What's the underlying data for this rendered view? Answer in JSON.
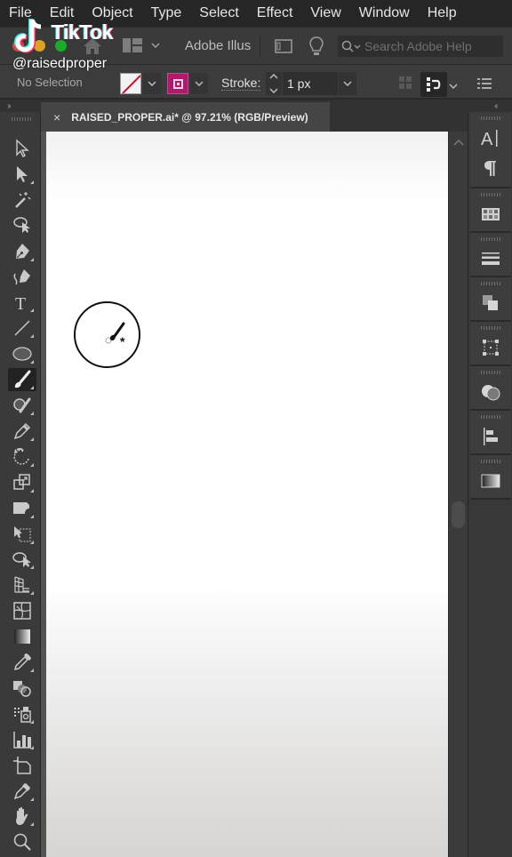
{
  "menubar": {
    "items": [
      "File",
      "Edit",
      "Object",
      "Type",
      "Select",
      "Effect",
      "View",
      "Window",
      "Help"
    ]
  },
  "appbar": {
    "workspace_label": "Adobe Illus",
    "search_placeholder": "Search Adobe Help",
    "icons": [
      "home-icon",
      "workspace-switcher-icon",
      "arrange-documents-icon",
      "lightbulb-icon",
      "search-icon"
    ]
  },
  "control_bar": {
    "selection_status": "No Selection",
    "fill": {
      "state": "none",
      "color": "#f2f2f2"
    },
    "stroke": {
      "color": "#b01a6d"
    },
    "stroke_label": "Stroke:",
    "stroke_weight": "1 px"
  },
  "document": {
    "tab_title": "RAISED_PROPER.ai* @ 97.21% (RGB/Preview)",
    "close_label": "×",
    "zoom": "97.21%",
    "color_mode": "RGB/Preview"
  },
  "toolbar": {
    "active_tool": "paintbrush-tool",
    "tools": [
      {
        "name": "selection-tool"
      },
      {
        "name": "direct-selection-tool"
      },
      {
        "name": "magic-wand-tool"
      },
      {
        "name": "lasso-tool"
      },
      {
        "name": "pen-tool"
      },
      {
        "name": "curvature-tool"
      },
      {
        "name": "type-tool"
      },
      {
        "name": "line-segment-tool"
      },
      {
        "name": "ellipse-tool"
      },
      {
        "name": "paintbrush-tool"
      },
      {
        "name": "shaper-tool"
      },
      {
        "name": "pencil-tool"
      },
      {
        "name": "rotate-tool"
      },
      {
        "name": "scale-tool"
      },
      {
        "name": "width-tool"
      },
      {
        "name": "free-transform-tool"
      },
      {
        "name": "shape-builder-tool"
      },
      {
        "name": "perspective-grid-tool"
      },
      {
        "name": "mesh-tool"
      },
      {
        "name": "gradient-tool"
      },
      {
        "name": "eyedropper-tool"
      },
      {
        "name": "blend-tool"
      },
      {
        "name": "symbol-sprayer-tool"
      },
      {
        "name": "column-graph-tool"
      },
      {
        "name": "artboard-tool"
      },
      {
        "name": "slice-tool"
      },
      {
        "name": "hand-tool"
      },
      {
        "name": "zoom-tool"
      }
    ]
  },
  "dock": {
    "panels": [
      {
        "name": "character-panel"
      },
      {
        "name": "paragraph-panel"
      },
      {
        "name": "swatches-panel"
      },
      {
        "name": "stroke-panel"
      },
      {
        "name": "pathfinder-panel"
      },
      {
        "name": "transform-panel"
      },
      {
        "name": "transparency-panel"
      },
      {
        "name": "align-panel"
      },
      {
        "name": "gradient-panel"
      }
    ]
  },
  "overlay": {
    "brand": "TikTok",
    "handle": "@raisedproper"
  },
  "colors": {
    "accent_stroke": "#b01a6d",
    "ui_dark": "#3a3a3a"
  }
}
